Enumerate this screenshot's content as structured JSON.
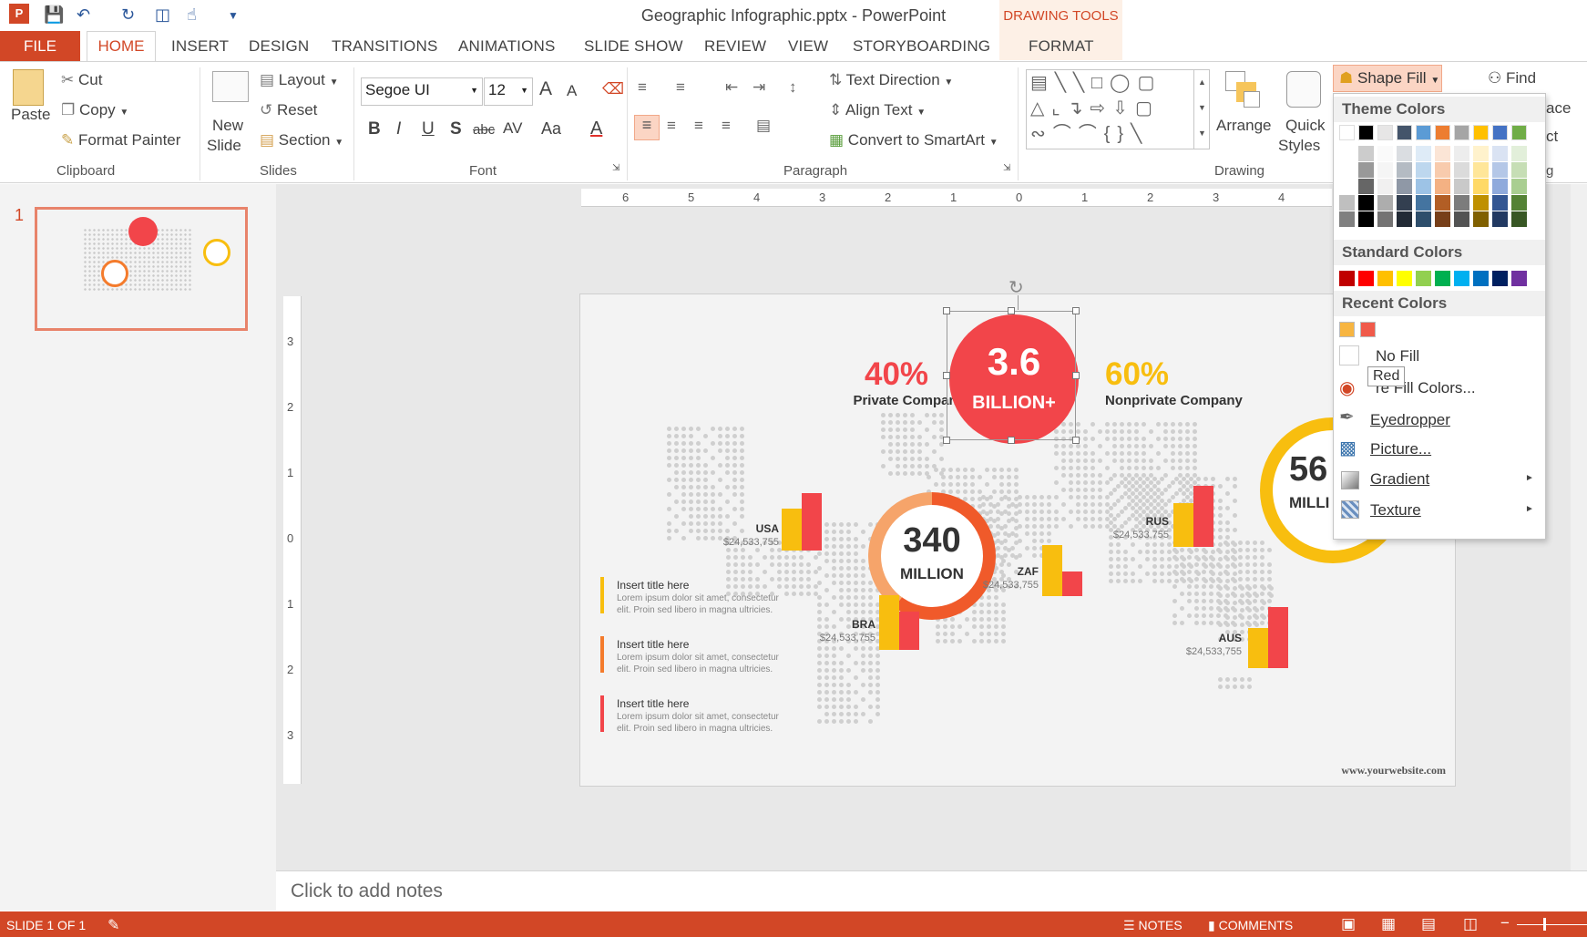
{
  "app": {
    "title": "Geographic Infographic.pptx - PowerPoint",
    "context_tab_group": "DRAWING TOOLS"
  },
  "tabs": [
    "FILE",
    "HOME",
    "INSERT",
    "DESIGN",
    "TRANSITIONS",
    "ANIMATIONS",
    "SLIDE SHOW",
    "REVIEW",
    "VIEW",
    "STORYBOARDING",
    "FORMAT"
  ],
  "ribbon": {
    "clipboard": {
      "paste": "Paste",
      "cut": "Cut",
      "copy": "Copy",
      "format_painter": "Format Painter",
      "label": "Clipboard"
    },
    "slides": {
      "new_slide_1": "New",
      "new_slide_2": "Slide",
      "layout": "Layout",
      "reset": "Reset",
      "section": "Section",
      "label": "Slides"
    },
    "font": {
      "name": "Segoe UI",
      "size": "12",
      "label": "Font",
      "bold": "B",
      "italic": "I",
      "underline": "U",
      "shadow": "S",
      "strike": "abc",
      "spacing": "AV",
      "case": "Aa",
      "color": "A",
      "grow": "A",
      "shrink": "A"
    },
    "paragraph": {
      "text_direction": "Text Direction",
      "align_text": "Align Text",
      "convert_smartart": "Convert to SmartArt",
      "label": "Paragraph"
    },
    "drawing": {
      "arrange": "Arrange",
      "quick_1": "Quick",
      "quick_2": "Styles",
      "shape_fill": "Shape Fill",
      "label": "Drawing"
    },
    "editing": {
      "find": "Find",
      "replace_partial": "ace",
      "select_partial": "ct",
      "label_partial": "g"
    }
  },
  "thumbnail": {
    "number": "1"
  },
  "ruler": {
    "h": [
      "6",
      "5",
      "4",
      "3",
      "2",
      "1",
      "0",
      "1",
      "2",
      "3",
      "4"
    ],
    "v": [
      "3",
      "2",
      "1",
      "0",
      "1",
      "2",
      "3"
    ]
  },
  "slide": {
    "pct_left": "40%",
    "pct_left_label": "Private Company",
    "pct_right": "60%",
    "pct_right_label": "Nonprivate Company",
    "big_value": "3.6",
    "big_unit": "BILLION+",
    "mid_value": "340",
    "mid_unit": "MILLION",
    "right_value": "56",
    "right_unit": "MILLI",
    "countries": [
      {
        "code": "USA",
        "value": "$24,533,755"
      },
      {
        "code": "BRA",
        "value": "$24,533,755"
      },
      {
        "code": "ZAF",
        "value": "$24,533,755"
      },
      {
        "code": "RUS",
        "value": "$24,533,755"
      },
      {
        "code": "AUS",
        "value": "$24,533,755"
      }
    ],
    "items": [
      {
        "title": "Insert title here",
        "line1": "Lorem ipsum dolor sit amet, consectetur",
        "line2": "elit. Proin sed libero in magna ultricies."
      },
      {
        "title": "Insert title here",
        "line1": "Lorem ipsum dolor sit amet, consectetur",
        "line2": "elit. Proin sed libero in magna ultricies."
      },
      {
        "title": "Insert title here",
        "line1": "Lorem ipsum dolor sit amet, consectetur",
        "line2": "elit. Proin sed libero in magna ultricies."
      }
    ],
    "website": "www.yourwebsite.com"
  },
  "notes": {
    "placeholder": "Click to add notes"
  },
  "fill_menu": {
    "theme_colors": "Theme Colors",
    "standard_colors": "Standard Colors",
    "recent_colors": "Recent Colors",
    "no_fill": "No Fill",
    "tooltip": "Red",
    "more_fill": "More Fill Colors...",
    "more_fill_visible": "re Fill Colors...",
    "eyedropper": "Eyedropper",
    "picture": "Picture...",
    "gradient": "Gradient",
    "texture": "Texture"
  },
  "colors": {
    "accent": "#d24726",
    "red": "#f2454a",
    "orange": "#f47b2c",
    "yellow": "#f8be0f",
    "theme_top": [
      "#ffffff",
      "#000000",
      "#e7e6e6",
      "#44546a",
      "#5b9bd5",
      "#ed7d31",
      "#a5a5a5",
      "#ffc000",
      "#4472c4",
      "#70ad47"
    ],
    "standard": [
      "#c00000",
      "#ff0000",
      "#ffc000",
      "#ffff00",
      "#92d050",
      "#00b050",
      "#00b0f0",
      "#0070c0",
      "#002060",
      "#7030a0"
    ],
    "recent": [
      "#f7b541",
      "#f05a4a"
    ]
  },
  "status": {
    "slide": "SLIDE 1 OF 1",
    "notes": "NOTES",
    "comments": "COMMENTS"
  }
}
